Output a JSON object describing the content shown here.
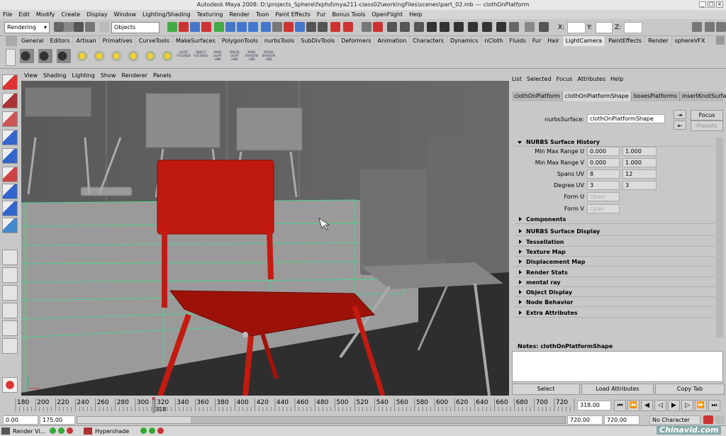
{
  "window": {
    "title": "Autodesk Maya 2008: D:\\projects_Sphere\\fxphd\\mya211-class02\\workingFiles\\scenes\\part_02.mb   ---   clothOnPlatform"
  },
  "menubar": [
    "File",
    "Edit",
    "Modify",
    "Create",
    "Display",
    "Window",
    "Lighting/Shading",
    "Texturing",
    "Render",
    "Toon",
    "Paint Effects",
    "Fur",
    "Bonus Tools",
    "OpenFlight",
    "Help"
  ],
  "statusline": {
    "mode": "Rendering",
    "selection_mask": "Objects",
    "x_label": "X:",
    "y_label": "Y:",
    "z_label": "Z:"
  },
  "shelf_tabs": [
    "General",
    "Editors",
    "Artisan",
    "Primatives",
    "CurveTools",
    "MakeSurfaces",
    "PolygonTools",
    "nurbsTools",
    "SubDivTools",
    "Deformers",
    "Animation",
    "Characters",
    "Dynamics",
    "nCloth",
    "Fluids",
    "Fur",
    "Hair",
    "LightCamera",
    "PaintEffects",
    "Render",
    "sphereVFX"
  ],
  "shelf_active": "LightCamera",
  "shelf_buttons": [
    "LIGHT FOCUSED",
    "OBJECT FOCUSED",
    "MAKE LIGHT LINK",
    "BREAK LIGHT LINK",
    "MAKE SHADOW LINK",
    "BREAK SHADOW LINK"
  ],
  "panel_menu": [
    "View",
    "Shading",
    "Lighting",
    "Show",
    "Renderer",
    "Panels"
  ],
  "attribute_editor": {
    "menu": [
      "List",
      "Selected",
      "Focus",
      "Attributes",
      "Help"
    ],
    "tabs": [
      "clothOnPlatform",
      "clothOnPlatformShape",
      "boxesPlatforms",
      "insertKnotSurface1"
    ],
    "active_tab": "clothOnPlatformShape",
    "node_label": "nurbsSurface:",
    "node_value": "clothOnPlatformShape",
    "focus_button": "Focus",
    "presets_button": "Presets",
    "history_section": "NURBS Surface History",
    "fields": [
      {
        "label": "Min Max Range U",
        "a": "0.000",
        "b": "1.000"
      },
      {
        "label": "Min Max Range V",
        "a": "0.000",
        "b": "1.000"
      },
      {
        "label": "Spans UV",
        "a": "8",
        "b": "12"
      },
      {
        "label": "Degree UV",
        "a": "3",
        "b": "3"
      }
    ],
    "form_u_label": "Form U",
    "form_u_value": "Open",
    "form_v_label": "Form V",
    "form_v_value": "Open",
    "sections": [
      "Components",
      "NURBS Surface Display",
      "Tessellation",
      "Texture Map",
      "Displacement Map",
      "Render Stats",
      "mental ray",
      "Object Display",
      "Node Behavior",
      "Extra Attributes"
    ],
    "notes_label": "Notes:  clothOnPlatformShape",
    "buttons": [
      "Select",
      "Load Attributes",
      "Copy Tab"
    ]
  },
  "timeslider": {
    "ticks": [
      "180",
      "200",
      "220",
      "240",
      "260",
      "280",
      "300",
      "320",
      "340",
      "360",
      "380",
      "400",
      "420",
      "440",
      "460",
      "480",
      "500",
      "520",
      "540",
      "560",
      "580",
      "600",
      "620",
      "640",
      "660",
      "680",
      "700",
      "720",
      "74"
    ],
    "current_marker": "318",
    "current_frame": "318.00",
    "colors": {
      "accent": "#cc2222"
    }
  },
  "range": {
    "start": "0.00",
    "start2": "175.00",
    "end2": "720.00",
    "end": "720.00",
    "character_set": "No Character Set"
  },
  "taskbar": {
    "items": [
      "Render Vi...",
      "Hypershade"
    ],
    "watermark": "Chinavid.com"
  }
}
